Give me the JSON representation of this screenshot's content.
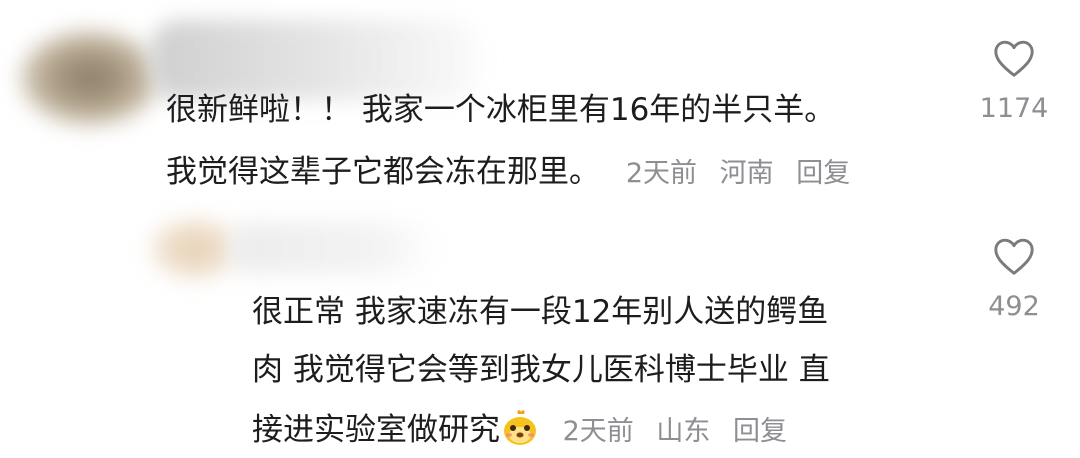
{
  "comments": [
    {
      "lines": [
        "很新鲜啦！！ 我家一个冰柜里有16年的半只羊。",
        "我觉得这辈子它都会冻在那里。"
      ],
      "meta": {
        "time": "2天前",
        "location": "河南",
        "reply": "回复"
      },
      "likes": "1174"
    },
    {
      "lines": [
        "很正常 我家速冻有一段12年别人送的鳄鱼",
        "肉 我觉得它会等到我女儿医科博士毕业 直",
        "接进实验室做研究"
      ],
      "emoji": "cartoon-face-emoji",
      "meta": {
        "time": "2天前",
        "location": "山东",
        "reply": "回复"
      },
      "likes": "492"
    }
  ],
  "icons": {
    "like": "heart-outline-icon"
  },
  "colors": {
    "text": "#1d1d1f",
    "meta": "#8e8e93",
    "background": "#ffffff"
  }
}
